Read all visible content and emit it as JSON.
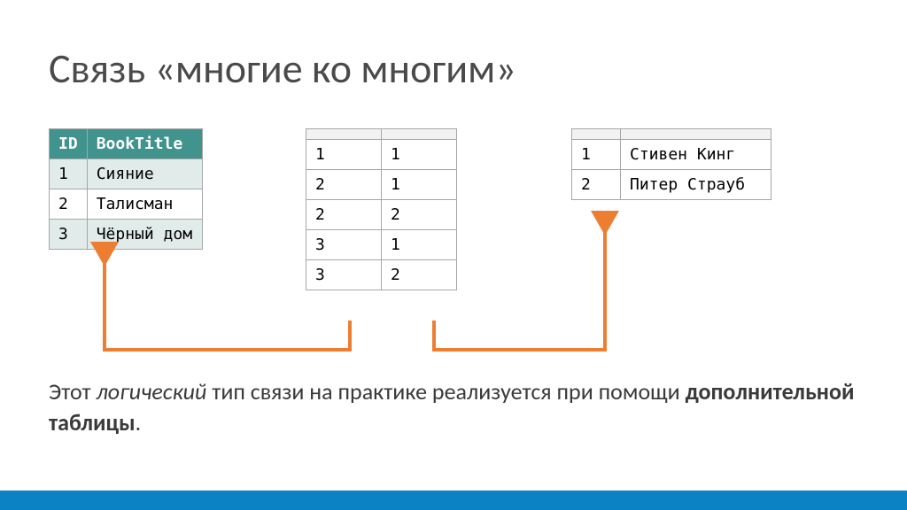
{
  "title": "Связь «многие ко многим»",
  "tables": {
    "books": {
      "header": {
        "id": "ID",
        "title": "BookTitle"
      },
      "rows": [
        {
          "id": "1",
          "title": "Сияние"
        },
        {
          "id": "2",
          "title": "Талисман"
        },
        {
          "id": "3",
          "title": "Чёрный дом"
        }
      ]
    },
    "junction": {
      "rows": [
        {
          "a": "1",
          "b": "1"
        },
        {
          "a": "2",
          "b": "1"
        },
        {
          "a": "2",
          "b": "2"
        },
        {
          "a": "3",
          "b": "1"
        },
        {
          "a": "3",
          "b": "2"
        }
      ]
    },
    "authors": {
      "rows": [
        {
          "id": "1",
          "name": "Стивен Кинг"
        },
        {
          "id": "2",
          "name": "Питер Страуб"
        }
      ]
    }
  },
  "caption": {
    "p1": "Этот ",
    "em": "логический",
    "p2": " тип связи на практике реализуется при помощи ",
    "strong": "дополнительной таблицы",
    "p3": "."
  },
  "colors": {
    "connector": "#ED7D31",
    "accent": "#41938e",
    "footer": "#0b82c4"
  }
}
